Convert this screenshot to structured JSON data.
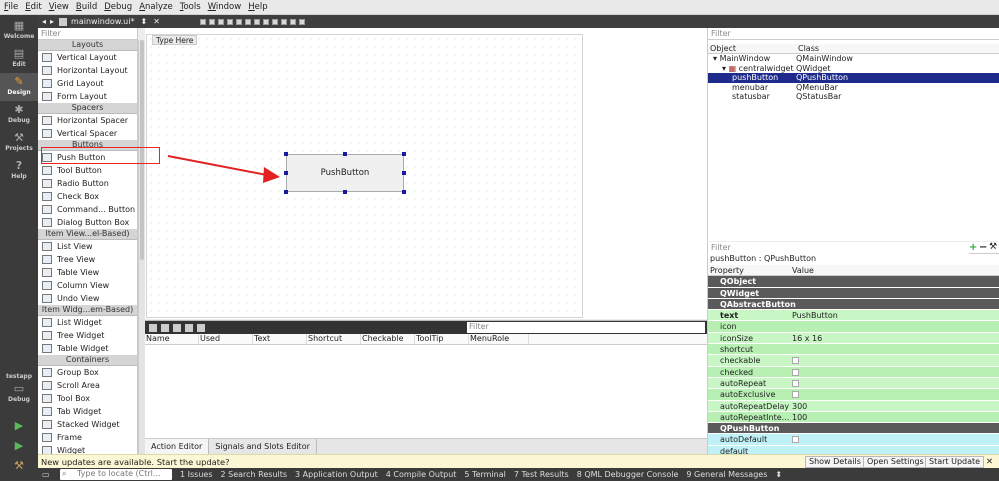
{
  "menu": [
    "File",
    "Edit",
    "View",
    "Build",
    "Debug",
    "Analyze",
    "Tools",
    "Window",
    "Help"
  ],
  "modes": [
    {
      "label": "Welcome",
      "icon": "grid-icon"
    },
    {
      "label": "Edit",
      "icon": "document-icon"
    },
    {
      "label": "Design",
      "icon": "pencil-icon"
    },
    {
      "label": "Debug",
      "icon": "bug-icon"
    },
    {
      "label": "Projects",
      "icon": "wrench-icon"
    },
    {
      "label": "Help",
      "icon": "help-icon"
    }
  ],
  "kit": {
    "project": "testapp",
    "mode": "Debug"
  },
  "document": {
    "tab": "mainwindow.ui*"
  },
  "widgetbox": {
    "filter": "Filter",
    "sections": [
      {
        "title": "Layouts",
        "items": [
          "Vertical Layout",
          "Horizontal Layout",
          "Grid Layout",
          "Form Layout"
        ]
      },
      {
        "title": "Spacers",
        "items": [
          "Horizontal Spacer",
          "Vertical Spacer"
        ]
      },
      {
        "title": "Buttons",
        "items": [
          "Push Button",
          "Tool Button",
          "Radio Button",
          "Check Box",
          "Command... Button",
          "Dialog Button Box"
        ]
      },
      {
        "title": "Item View...el-Based)",
        "items": [
          "List View",
          "Tree View",
          "Table View",
          "Column View",
          "Undo View"
        ]
      },
      {
        "title": "Item Widg...em-Based)",
        "items": [
          "List Widget",
          "Tree Widget",
          "Table Widget"
        ]
      },
      {
        "title": "Containers",
        "items": [
          "Group Box",
          "Scroll Area",
          "Tool Box",
          "Tab Widget",
          "Stacked Widget",
          "Frame",
          "Widget"
        ]
      }
    ]
  },
  "form": {
    "type_here": "Type Here",
    "button_text": "PushButton"
  },
  "action_editor": {
    "filter": "Filter",
    "columns": [
      "Name",
      "Used",
      "Text",
      "Shortcut",
      "Checkable",
      "ToolTip",
      "MenuRole"
    ],
    "tabs": [
      "Action Editor",
      "Signals and Slots Editor"
    ]
  },
  "object_inspector": {
    "filter": "Filter",
    "columns": [
      "Object",
      "Class"
    ],
    "rows": [
      {
        "object": "MainWindow",
        "class": "QMainWindow"
      },
      {
        "object": "centralwidget",
        "class": "QWidget"
      },
      {
        "object": "pushButton",
        "class": "QPushButton"
      },
      {
        "object": "menubar",
        "class": "QMenuBar"
      },
      {
        "object": "statusbar",
        "class": "QStatusBar"
      }
    ]
  },
  "property_editor": {
    "filter": "Filter",
    "subject": "pushButton : QPushButton",
    "columns": [
      "Property",
      "Value"
    ],
    "groups": [
      "QObject",
      "QWidget",
      "QAbstractButton",
      "QPushButton"
    ],
    "rows": [
      {
        "name": "text",
        "value": "PushButton"
      },
      {
        "name": "icon",
        "value": ""
      },
      {
        "name": "iconSize",
        "value": "16 x 16"
      },
      {
        "name": "shortcut",
        "value": ""
      },
      {
        "name": "checkable",
        "value": ""
      },
      {
        "name": "checked",
        "value": ""
      },
      {
        "name": "autoRepeat",
        "value": ""
      },
      {
        "name": "autoExclusive",
        "value": ""
      },
      {
        "name": "autoRepeatDelay",
        "value": "300"
      },
      {
        "name": "autoRepeatInte...",
        "value": "100"
      },
      {
        "name": "autoDefault",
        "value": ""
      },
      {
        "name": "default",
        "value": ""
      }
    ]
  },
  "notification": {
    "text": "New updates are available. Start the update?",
    "buttons": [
      "Show Details",
      "Open Settings",
      "Start Update"
    ]
  },
  "statusbar": {
    "locator": "Type to locate (Ctrl...",
    "panes": [
      "1 Issues",
      "2 Search Results",
      "3 Application Output",
      "4 Compile Output",
      "5 Terminal",
      "7 Test Results",
      "8 QML Debugger Console",
      "9 General Messages"
    ]
  },
  "colors": {
    "selection": "#1e2b8c",
    "annotation": "#e22222",
    "update_bar": "#fbf6d3"
  }
}
